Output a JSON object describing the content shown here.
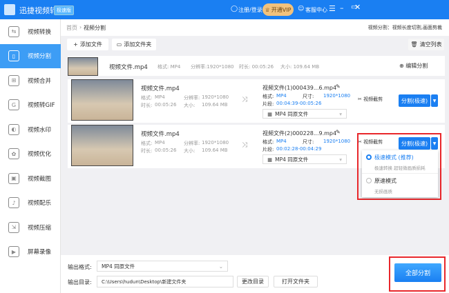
{
  "app": {
    "title": "迅捷视频转换器",
    "edition": "极速版",
    "login": "注册/登录",
    "vip": "开通VIP",
    "support": "客服中心"
  },
  "sidebar": [
    {
      "label": "视频转换",
      "icon": "convert-icon"
    },
    {
      "label": "视频分割",
      "icon": "split-icon"
    },
    {
      "label": "视频合并",
      "icon": "merge-icon"
    },
    {
      "label": "视频转GIF",
      "icon": "gif-icon"
    },
    {
      "label": "视频水印",
      "icon": "watermark-icon"
    },
    {
      "label": "视频优化",
      "icon": "optimize-icon"
    },
    {
      "label": "视频截图",
      "icon": "screenshot-icon"
    },
    {
      "label": "视频配乐",
      "icon": "music-icon"
    },
    {
      "label": "视频压缩",
      "icon": "compress-icon"
    },
    {
      "label": "屏幕录像",
      "icon": "record-icon"
    }
  ],
  "breadcrumb": {
    "home": "首页",
    "current": "视频分割",
    "hint": "视频分割：视频长度切割,画面剪裁"
  },
  "toolbar": {
    "add_file": "添加文件",
    "add_folder": "添加文件夹",
    "clear": "清空列表"
  },
  "source": {
    "name": "视频文件.mp4",
    "format": "格式: MP4",
    "resolution": "分辨率:1920*1080",
    "duration": "时长: 00:05:26",
    "size": "大小: 109.64 MB",
    "edit": "编辑分割"
  },
  "labels": {
    "format": "格式:",
    "resolution": "分辨率:",
    "duration": "时长:",
    "size": "大小:",
    "dim": "尺寸:",
    "segment": "片段:",
    "crop": "视频截剪",
    "split": "分割(极速)"
  },
  "segments": [
    {
      "src_name": "视频文件.mp4",
      "src_format": "MP4",
      "src_res": "1920*1080",
      "src_dur": "00:05:26",
      "src_size": "109.64 MB",
      "out_name": "视频文件(1)000439...6.mp4",
      "out_format": "MP4",
      "out_dim": "1920*1080",
      "out_range": "00:04:39-00:05:26",
      "out_select": "MP4  同原文件"
    },
    {
      "src_name": "视频文件.mp4",
      "src_format": "MP4",
      "src_res": "1920*1080",
      "src_dur": "00:05:26",
      "src_size": "109.64 MB",
      "out_name": "视频文件(2)000228...9.mp4",
      "out_format": "MP4",
      "out_dim": "1920*1080",
      "out_range": "00:02:28-00:04:29",
      "out_select": "MP4  同原文件"
    }
  ],
  "dropdown": {
    "fast_title": "极速模式 (推荐)",
    "fast_desc": "极速转换 超轻微画质损耗",
    "orig_title": "原速模式",
    "orig_desc": "无损画质"
  },
  "bottom": {
    "format_label": "输出格式:",
    "format_value": "MP4  同原文件",
    "dir_label": "输出目录:",
    "dir_value": "C:\\Users\\hudun\\Desktop\\新建文件夹",
    "change_dir": "更改目录",
    "open_folder": "打开文件夹",
    "split_all": "全部分割"
  }
}
